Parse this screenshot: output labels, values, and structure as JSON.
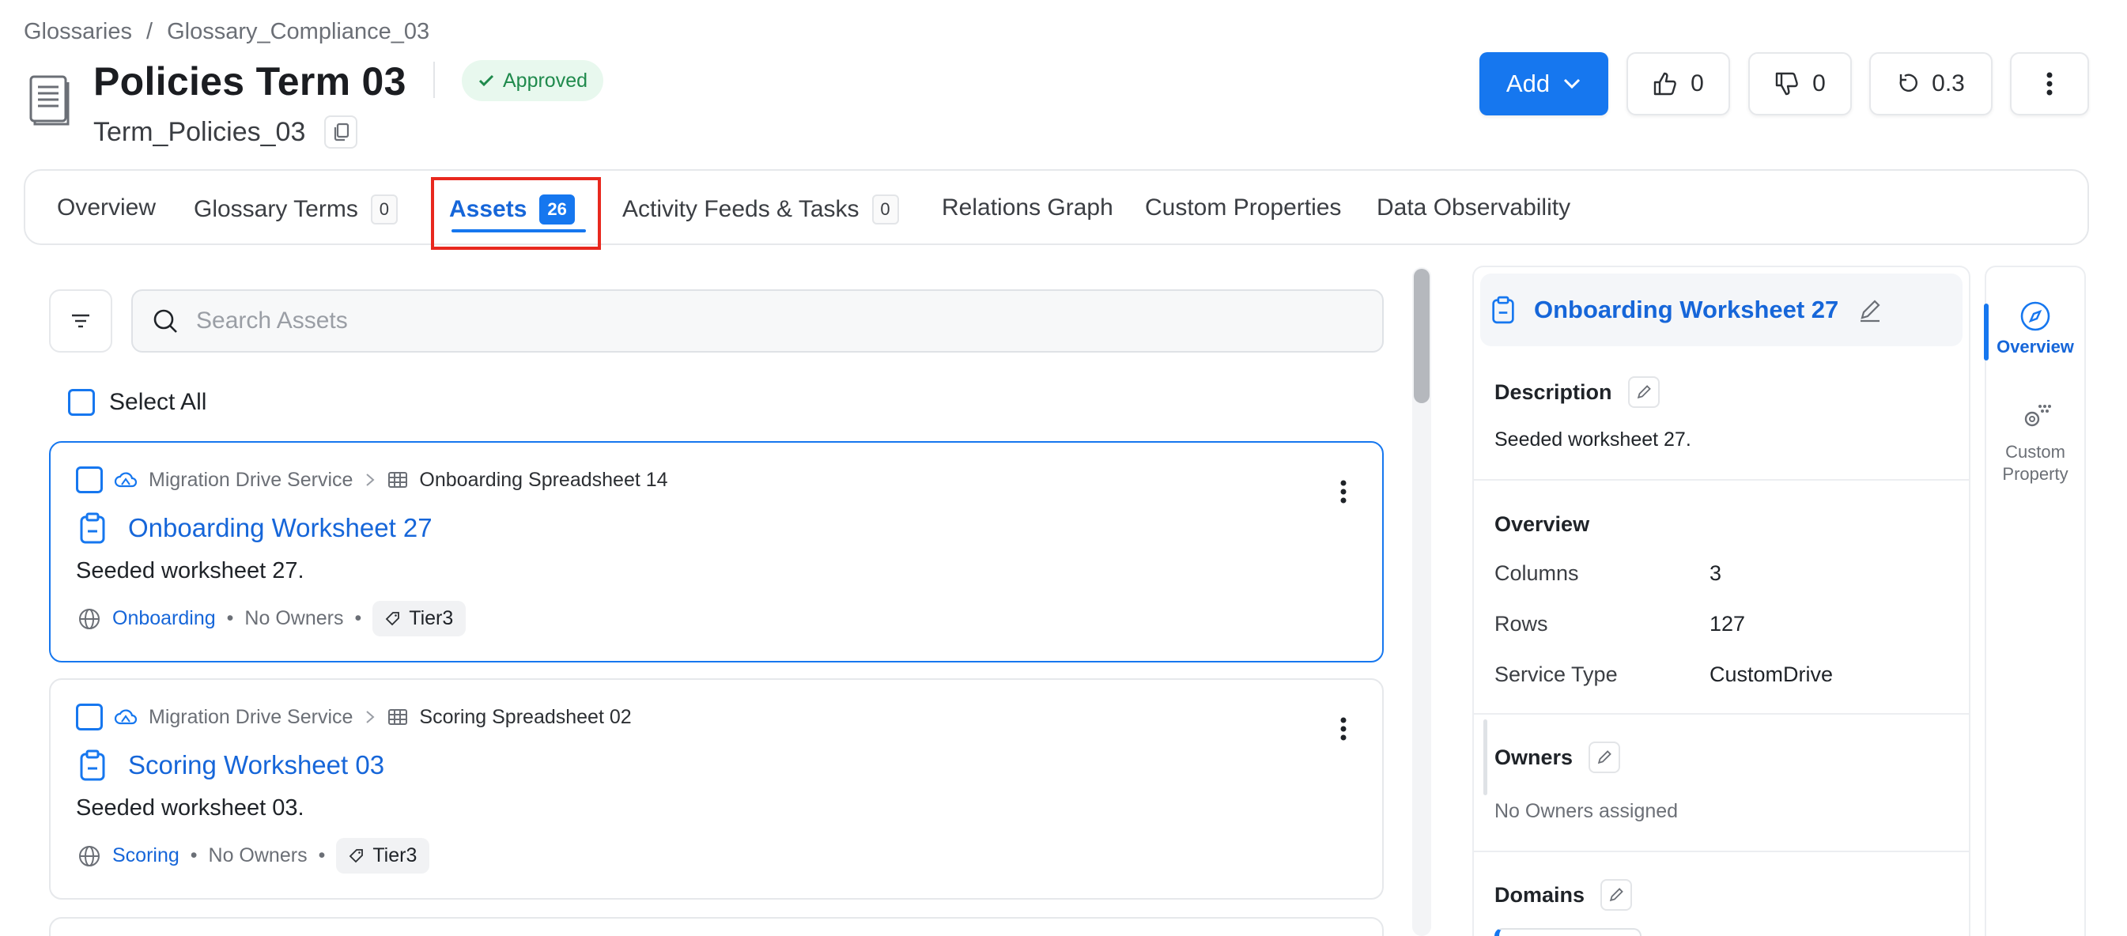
{
  "breadcrumb": {
    "root": "Glossaries",
    "separator": "/",
    "current": "Glossary_Compliance_03"
  },
  "header": {
    "title": "Policies Term 03",
    "status": "Approved",
    "display_name": "Term_Policies_03",
    "add_label": "Add",
    "likes": "0",
    "dislikes": "0",
    "version": "0.3"
  },
  "tabs": [
    {
      "label": "Overview"
    },
    {
      "label": "Glossary Terms",
      "count": "0"
    },
    {
      "label": "Assets",
      "count": "26"
    },
    {
      "label": "Activity Feeds & Tasks",
      "count": "0"
    },
    {
      "label": "Relations Graph"
    },
    {
      "label": "Custom Properties"
    },
    {
      "label": "Data Observability"
    }
  ],
  "active_tab": "Assets",
  "search": {
    "placeholder": "Search Assets",
    "value": ""
  },
  "select_all_label": "Select All",
  "assets": [
    {
      "service": "Migration Drive Service",
      "parent": "Onboarding Spreadsheet 14",
      "name": "Onboarding Worksheet 27",
      "description": "Seeded worksheet 27.",
      "domain": "Onboarding",
      "owners": "No Owners",
      "tier": "Tier3",
      "selected": true
    },
    {
      "service": "Migration Drive Service",
      "parent": "Scoring Spreadsheet 02",
      "name": "Scoring Worksheet 03",
      "description": "Seeded worksheet 03.",
      "domain": "Scoring",
      "owners": "No Owners",
      "tier": "Tier3",
      "selected": false
    }
  ],
  "panel": {
    "title": "Onboarding Worksheet 27",
    "description_label": "Description",
    "description": "Seeded worksheet 27.",
    "overview_label": "Overview",
    "overview": [
      {
        "key": "Columns",
        "value": "3"
      },
      {
        "key": "Rows",
        "value": "127"
      },
      {
        "key": "Service Type",
        "value": "CustomDrive"
      }
    ],
    "owners_label": "Owners",
    "owners_empty": "No Owners assigned",
    "domains_label": "Domains"
  },
  "rail": [
    {
      "label": "Overview",
      "active": true
    },
    {
      "label": "Custom Property",
      "active": false
    }
  ],
  "colors": {
    "primary": "#1677ef",
    "approved_bg": "#e8f8ee",
    "approved_text": "#1f8a4c",
    "highlight": "#e8281e"
  }
}
